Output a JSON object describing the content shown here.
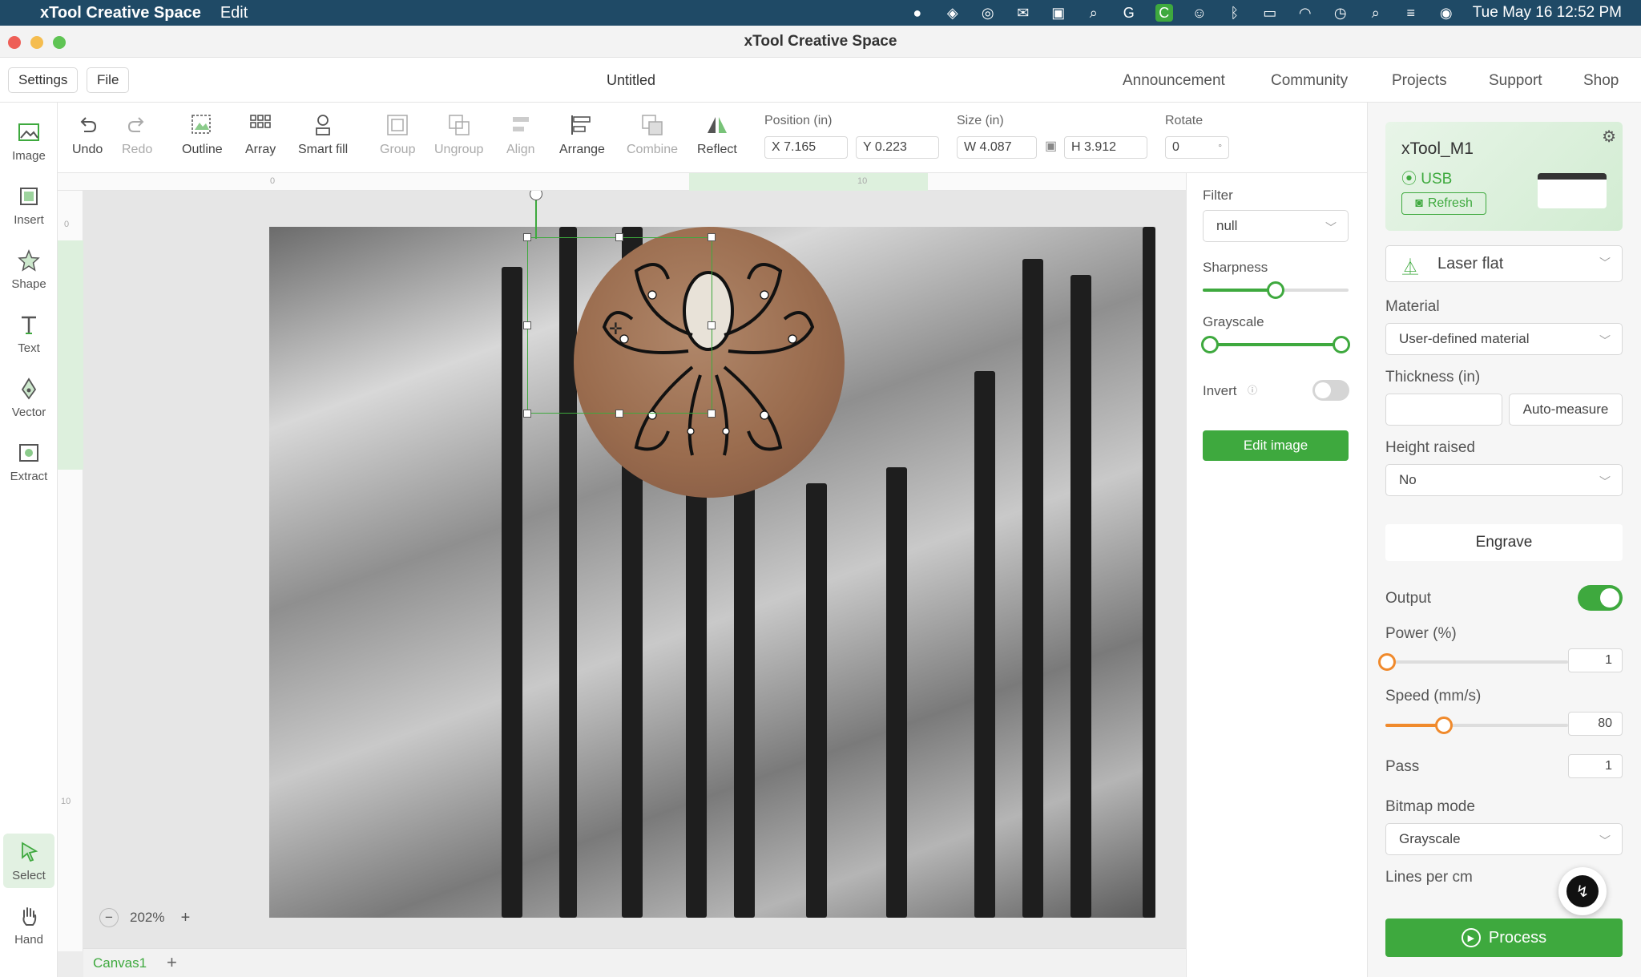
{
  "menubar": {
    "app_name": "xTool Creative Space",
    "menu_edit": "Edit",
    "clock": "Tue May 16  12:52 PM"
  },
  "window": {
    "title": "xTool Creative Space"
  },
  "appbar": {
    "settings": "Settings",
    "file": "File",
    "doc_title": "Untitled",
    "nav": [
      "Announcement",
      "Community",
      "Projects",
      "Support",
      "Shop"
    ]
  },
  "left_tools": [
    {
      "label": "Image",
      "icon": "image-icon"
    },
    {
      "label": "Insert",
      "icon": "insert-icon"
    },
    {
      "label": "Shape",
      "icon": "shape-icon"
    },
    {
      "label": "Text",
      "icon": "text-icon"
    },
    {
      "label": "Vector",
      "icon": "vector-pen-icon"
    },
    {
      "label": "Extract",
      "icon": "extract-icon"
    },
    {
      "label": "Select",
      "icon": "select-cursor-icon"
    },
    {
      "label": "Hand",
      "icon": "hand-icon"
    }
  ],
  "toolbar": {
    "undo": "Undo",
    "redo": "Redo",
    "outline": "Outline",
    "array": "Array",
    "smart_fill": "Smart fill",
    "group": "Group",
    "ungroup": "Ungroup",
    "align": "Align",
    "arrange": "Arrange",
    "combine": "Combine",
    "reflect": "Reflect",
    "position_label": "Position (in)",
    "x_value": "X 7.165",
    "y_value": "Y 0.223",
    "size_label": "Size (in)",
    "w_value": "W 4.087",
    "h_value": "H 3.912",
    "rotate_label": "Rotate",
    "rotate_value": "0",
    "rotate_unit": "°"
  },
  "ruler": {
    "mark_0": "0",
    "mark_10": "10",
    "vmark_0": "0",
    "vmark_10": "10"
  },
  "canvas": {
    "zoom": "202%",
    "tab": "Canvas1"
  },
  "image_panel": {
    "filter_label": "Filter",
    "filter_value": "null",
    "sharpness_label": "Sharpness",
    "sharpness_level": 0.5,
    "grayscale_label": "Grayscale",
    "grayscale_range": [
      0,
      1
    ],
    "invert_label": "Invert",
    "invert_on": false,
    "edit_image": "Edit image"
  },
  "device": {
    "name": "xTool_M1",
    "connection": "USB",
    "refresh": "Refresh",
    "mode": "Laser flat"
  },
  "settings": {
    "material_label": "Material",
    "material_value": "User-defined material",
    "thickness_label": "Thickness (in)",
    "thickness_value": "",
    "auto_measure": "Auto-measure",
    "height_raised_label": "Height raised",
    "height_raised_value": "No",
    "engrave": "Engrave",
    "output_label": "Output",
    "output_on": true,
    "power_label": "Power (%)",
    "power_value": "1",
    "speed_label": "Speed (mm/s)",
    "speed_value": "80",
    "pass_label": "Pass",
    "pass_value": "1",
    "bitmap_label": "Bitmap mode",
    "bitmap_value": "Grayscale",
    "lines_label": "Lines per cm",
    "process": "Process"
  },
  "colors": {
    "accent_green": "#3ea93e",
    "orange": "#f08a2c",
    "menubar": "#1f4a66"
  }
}
